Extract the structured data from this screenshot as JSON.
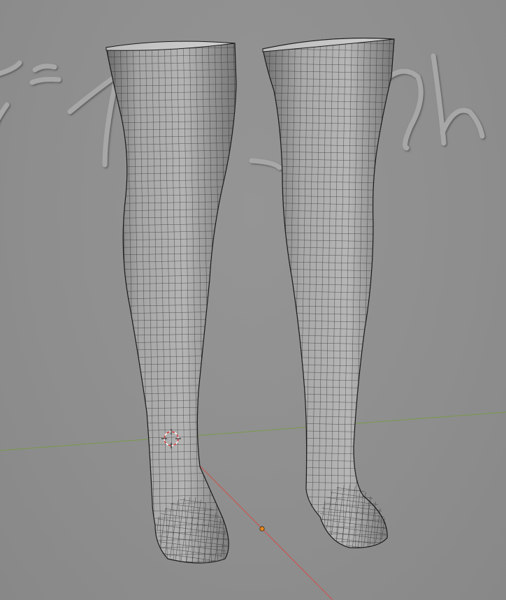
{
  "viewport": {
    "mode": "3d-viewport",
    "background_color": "#8f8f8f",
    "mesh_color": "#a9a9a9",
    "wire_color": "#1a1a1a",
    "x_axis_color": "#c9564f",
    "y_axis_color": "#7a9a4a",
    "origin_color": "#e8871e",
    "cursor_colors": [
      "#d23b3b",
      "#ffffff"
    ]
  },
  "scene": {
    "objects": [
      {
        "name": "left-thigh-high-stocking",
        "type": "mesh",
        "display": "wireframe-overlay"
      },
      {
        "name": "right-thigh-high-stocking",
        "type": "mesh",
        "display": "wireframe-overlay"
      },
      {
        "name": "background-3d-script-text",
        "type": "text-curve",
        "display": "solid"
      }
    ],
    "gizmos": [
      "3d-cursor",
      "object-origin",
      "x-axis-line",
      "y-axis-line"
    ]
  }
}
